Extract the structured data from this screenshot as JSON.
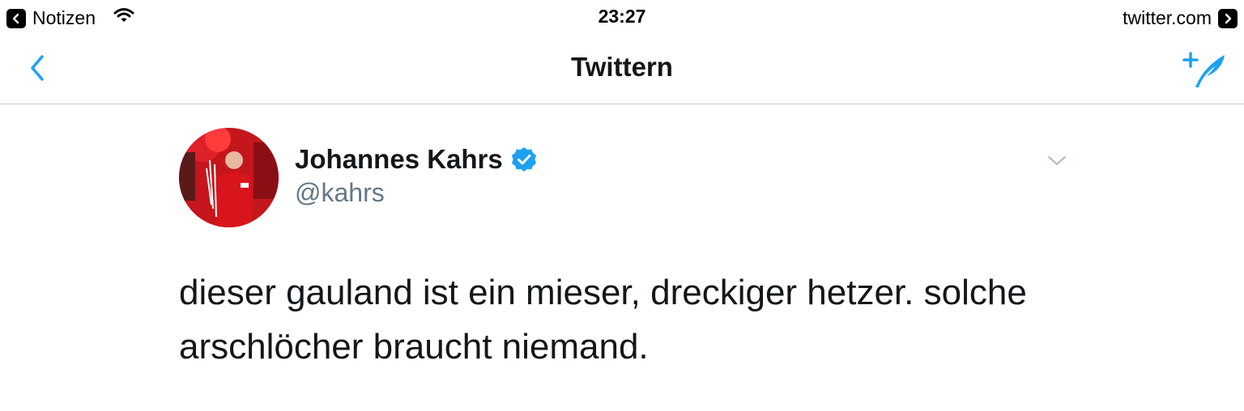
{
  "status_bar": {
    "back_app": "Notizen",
    "time": "23:27",
    "site": "twitter.com"
  },
  "nav": {
    "title": "Twittern",
    "back_icon": "chevron-left-icon",
    "compose_icon": "compose-tweet-icon"
  },
  "tweet": {
    "author_name": "Johannes Kahrs",
    "handle": "@kahrs",
    "text": "dieser gauland ist ein mieser, dreckiger hetzer. solche arschlöcher braucht niemand."
  },
  "colors": {
    "accent": "#1da1f2",
    "text": "#14171a",
    "secondary": "#657786",
    "divider": "#c8c7cc"
  }
}
